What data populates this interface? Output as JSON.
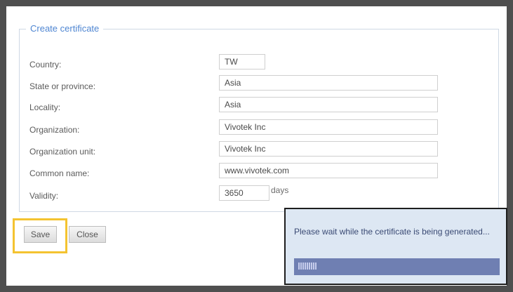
{
  "dialog": {
    "legend": "Create certificate",
    "fields": [
      {
        "label": "Country:",
        "value": "TW"
      },
      {
        "label": "State or province:",
        "value": "Asia"
      },
      {
        "label": "Locality:",
        "value": "Asia"
      },
      {
        "label": "Organization:",
        "value": "Vivotek Inc"
      },
      {
        "label": "Organization unit:",
        "value": "Vivotek Inc"
      },
      {
        "label": "Common name:",
        "value": "www.vivotek.com"
      },
      {
        "label": "Validity:",
        "value": "3650"
      }
    ],
    "validity_unit": "days",
    "buttons": {
      "save": "Save",
      "close": "Close"
    }
  },
  "popup": {
    "message": "Please wait while the certificate is being generated...",
    "progress_fraction": 0.09
  },
  "colors": {
    "highlight": "#f4c330",
    "popup_background": "#dde7f3",
    "progress_track": "#6f7fb2"
  }
}
